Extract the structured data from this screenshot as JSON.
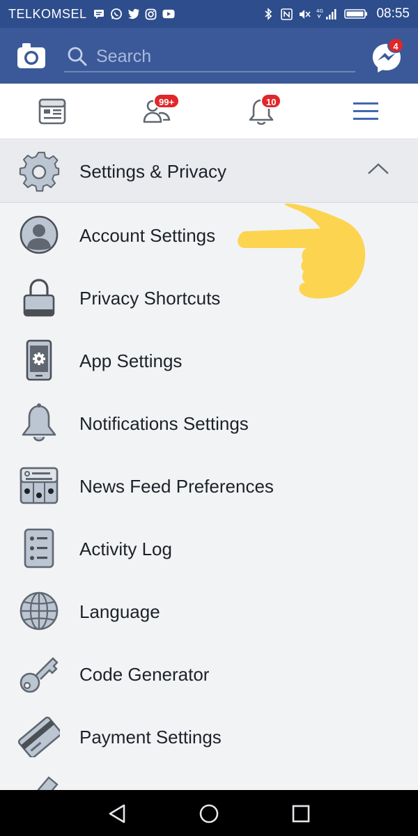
{
  "status_bar": {
    "carrier": "TELKOMSEL",
    "network": "4G",
    "time": "08:55"
  },
  "header": {
    "search": {
      "placeholder": "Search"
    },
    "messenger_badge": "4"
  },
  "nav": {
    "friends_badge": "99+",
    "notifications_badge": "10"
  },
  "section": {
    "title": "Settings & Privacy"
  },
  "menu_items": [
    {
      "label": "Account Settings",
      "icon": "account-icon"
    },
    {
      "label": "Privacy Shortcuts",
      "icon": "lock-icon"
    },
    {
      "label": "App Settings",
      "icon": "phone-gear-icon"
    },
    {
      "label": "Notifications Settings",
      "icon": "bell-icon"
    },
    {
      "label": "News Feed Preferences",
      "icon": "news-feed-icon"
    },
    {
      "label": "Activity Log",
      "icon": "activity-log-icon"
    },
    {
      "label": "Language",
      "icon": "globe-icon"
    },
    {
      "label": "Code Generator",
      "icon": "key-icon"
    },
    {
      "label": "Payment Settings",
      "icon": "credit-card-icon"
    }
  ],
  "colors": {
    "status_bar": "#2d4d8c",
    "brand_blue": "#3b5998",
    "badge_red": "#e02729",
    "list_bg": "#f2f3f5",
    "header_bg": "#e9ebee",
    "pointer_yellow": "#fcd450"
  }
}
